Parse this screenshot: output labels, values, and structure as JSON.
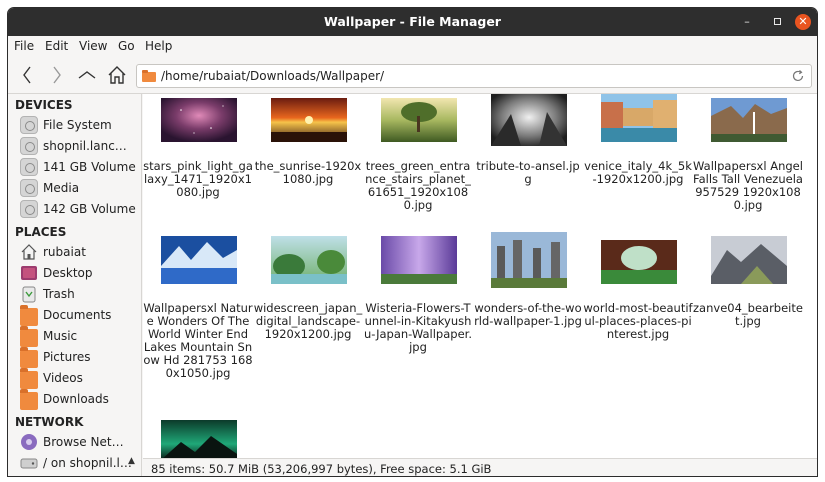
{
  "window": {
    "title": "Wallpaper - File Manager"
  },
  "menu": [
    "File",
    "Edit",
    "View",
    "Go",
    "Help"
  ],
  "location": {
    "path": "/home/rubaiat/Downloads/Wallpaper/"
  },
  "sidebar": {
    "devices_header": "DEVICES",
    "devices": [
      {
        "label": "File System",
        "icon": "drive-icon"
      },
      {
        "label": "shopnil.lanc…",
        "icon": "drive-icon"
      },
      {
        "label": "141 GB Volume",
        "icon": "drive-icon"
      },
      {
        "label": "Media",
        "icon": "drive-icon"
      },
      {
        "label": "142 GB Volume",
        "icon": "drive-icon"
      }
    ],
    "places_header": "PLACES",
    "places": [
      {
        "label": "rubaiat",
        "icon": "home-icon"
      },
      {
        "label": "Desktop",
        "icon": "desktop-icon"
      },
      {
        "label": "Trash",
        "icon": "trash-icon"
      },
      {
        "label": "Documents",
        "icon": "folder-icon"
      },
      {
        "label": "Music",
        "icon": "folder-icon"
      },
      {
        "label": "Pictures",
        "icon": "folder-icon"
      },
      {
        "label": "Videos",
        "icon": "folder-icon"
      },
      {
        "label": "Downloads",
        "icon": "folder-icon"
      }
    ],
    "network_header": "NETWORK",
    "network": [
      {
        "label": "Browse Net…",
        "icon": "network-icon"
      },
      {
        "label": "/ on shopnil.l…",
        "icon": "drive-icon"
      }
    ]
  },
  "files": [
    {
      "name": "stars_pink_light_galaxy_1471_1920x1080.jpg"
    },
    {
      "name": "the_sunrise-1920x1080.jpg"
    },
    {
      "name": "trees_green_entrance_stairs_planet_61651_1920x1080.jpg"
    },
    {
      "name": "tribute-to-ansel.jpg"
    },
    {
      "name": "venice_italy_4k_5k-1920x1200.jpg"
    },
    {
      "name": "Wallpapersxl Angel Falls Tall Venezuela 957529 1920x1080.jpg"
    },
    {
      "name": "Wallpapersxl Nature Wonders Of The World Winter End Lakes Mountain Snow Hd 281753 1680x1050.jpg"
    },
    {
      "name": "widescreen_japan_digital_landscape-1920x1200.jpg"
    },
    {
      "name": "Wisteria-Flowers-Tunnel-in-Kitakyushu-Japan-Wallpaper.jpg"
    },
    {
      "name": "wonders-of-the-world-wallpaper-1.jpg"
    },
    {
      "name": "world-most-beautiful-places-places-pinterest.jpg"
    },
    {
      "name": "zanve04_bearbeitet.jpg"
    },
    {
      "name": ""
    }
  ],
  "status": {
    "text": "85 items: 50.7 MiB (53,206,997 bytes), Free space: 5.1 GiB"
  },
  "colors": {
    "accent": "#e95420",
    "folder": "#f08a3e",
    "titlebar": "#2e2e2e"
  }
}
